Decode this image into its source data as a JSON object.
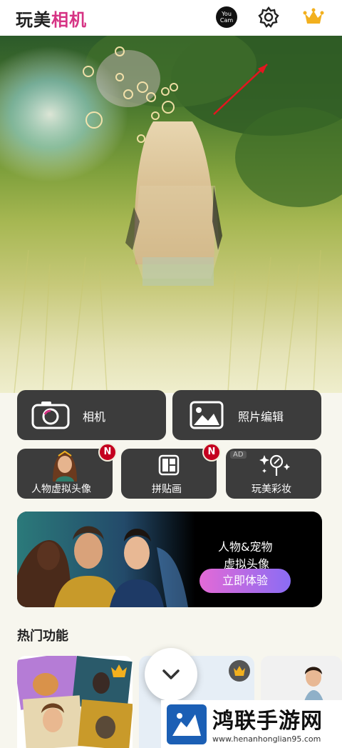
{
  "header": {
    "logo_part1": "玩美",
    "logo_part2": "相机",
    "youcam_badge": "YouCam",
    "icons": [
      "youcam-icon",
      "gear-icon",
      "crown-icon"
    ]
  },
  "actions": {
    "camera": "相机",
    "photo_edit": "照片编辑",
    "avatar": "人物虚拟头像",
    "collage": "拼贴画",
    "makeup": "玩美彩妆",
    "new_badge": "N",
    "ad_badge": "AD"
  },
  "banner": {
    "title_line1": "人物&宠物",
    "title_line2": "虚拟头像",
    "cta": "立即体验"
  },
  "hot_features": {
    "title": "热门功能"
  },
  "watermark": {
    "name": "鸿联手游网",
    "url": "www.henanhonglian95.com"
  },
  "colors": {
    "accent": "#d63384",
    "badge": "#c4001f",
    "crown": "#f2b01e"
  }
}
